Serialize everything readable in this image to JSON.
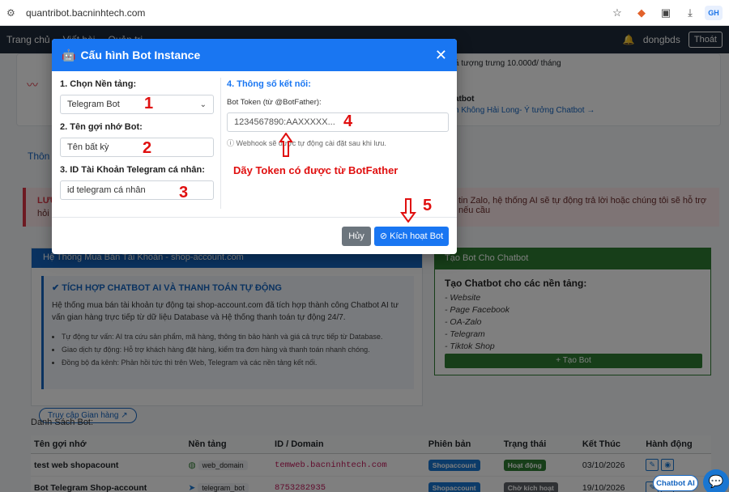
{
  "browser": {
    "url": "quantribot.bacninhtech.com",
    "profile_label": "GH"
  },
  "topnav": {
    "home": "Trang chủ",
    "posts": "Viết bài",
    "admin": "Quản trị",
    "user": "dongbds",
    "logout": "Thoát"
  },
  "background": {
    "price_note": "á tượng trưng 10.000đ/ tháng",
    "chatbot_link_title": "atbot",
    "chatbot_link": "h Không Hải Long- Ý tưởng Chatbot →",
    "tab_label": "Thôn",
    "alert_lead": "LƯU",
    "alert_text": "tin Zalo, hệ thống AI sẽ tự động trả lời hoặc chúng tôi sẽ hỗ trợ nếu cầu",
    "alert_line2": "hỏi n"
  },
  "shop_card": {
    "header": "Hệ Thống Mua Bán Tài Khoản - shop-account.com",
    "title": "TÍCH HỢP CHATBOT AI VÀ THANH TOÁN TỰ ĐỘNG",
    "desc": "Hệ thống mua bán tài khoản tự động tại shop-account.com đã tích hợp thành công Chatbot AI tư vấn gian hàng trực tiếp từ dữ liệu Database và Hệ thống thanh toán tự động 24/7.",
    "bullets": [
      "Tự động tư vấn: AI tra cứu sản phẩm, mã hàng, thông tin bảo hành và giá cả trực tiếp từ Database.",
      "Giao dịch tự động: Hỗ trợ khách hàng đặt hàng, kiểm tra đơn hàng và thanh toán nhanh chóng.",
      "Đồng bộ đa kênh: Phản hồi tức thì trên Web, Telegram và các nền tảng kết nối."
    ],
    "visit_button": "Truy cập Gian hàng ↗"
  },
  "create_card": {
    "header": "Tạo Bot Cho Chatbot",
    "subtitle": "Tạo Chatbot cho các nền tảng:",
    "items": [
      "- Website",
      "- Page Facebook",
      "- OA-Zalo",
      "- Telegram",
      "- Tiktok Shop"
    ],
    "add_button": "+ Tạo Bot"
  },
  "bot_list": {
    "title": "Danh Sách Bot:",
    "columns": [
      "Tên gợi nhớ",
      "Nền tảng",
      "ID / Domain",
      "Phiên bản",
      "Trạng thái",
      "Kết Thúc",
      "Hành động"
    ],
    "rows": [
      {
        "name": "test web shopacount",
        "platform": "web_domain",
        "id": "temweb.bacninhtech.com",
        "version": "Shopaccount",
        "status": "Hoạt động",
        "end": "03/10/2026"
      },
      {
        "name": "Bot Telegram Shop-account",
        "platform": "telegram_bot",
        "id": "8753282935",
        "version": "Shopaccount",
        "status": "Chờ kích hoạt",
        "end": "19/10/2026"
      }
    ]
  },
  "floating": {
    "chatbot_ai": "Chatbot AI"
  },
  "modal": {
    "title": "Cấu hình Bot Instance",
    "step1_label": "1. Chọn Nền tảng:",
    "platform_value": "Telegram Bot",
    "step2_label": "2. Tên gợi nhớ Bot:",
    "name_placeholder": "Tên bất kỳ",
    "step3_label": "3. ID Tài Khoản Telegram cá nhân:",
    "id_placeholder": "id telegram cá nhân",
    "step4_title": "4. Thông số kết nối:",
    "token_label": "Bot Token (từ @BotFather):",
    "token_placeholder": "1234567890:AAXXXXX...",
    "webhook_hint": "ⓘ Webhook sẽ được tự động cài đặt sau khi lưu.",
    "cancel": "Hủy",
    "activate": "⊘ Kích hoạt Bot"
  },
  "annotations": {
    "n1": "1",
    "n2": "2",
    "n3": "3",
    "n4": "4",
    "n5": "5",
    "token_note": "Dãy Token có được từ BotFather"
  },
  "colors": {
    "primary": "#1976f2",
    "annotation_red": "#e01010",
    "success": "#2e7d32"
  }
}
